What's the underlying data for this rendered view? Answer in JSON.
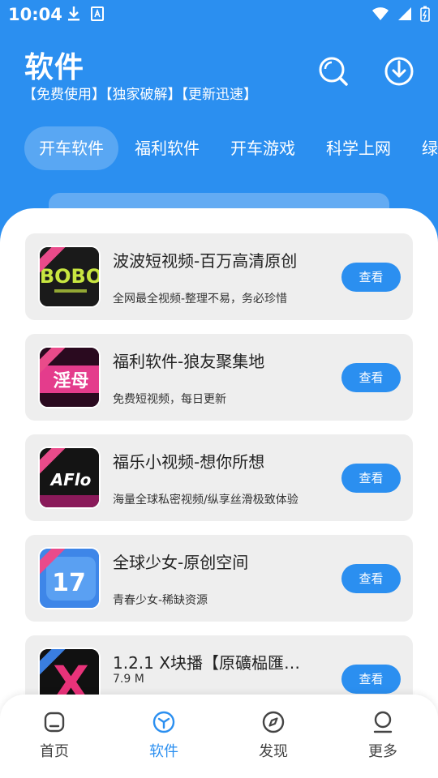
{
  "status_bar": {
    "time": "10:04"
  },
  "header": {
    "title": "软件",
    "subtitle": "【免费使用】【独家破解】【更新迅速】"
  },
  "tabs": [
    {
      "label": "开车软件",
      "active": true
    },
    {
      "label": "福利软件",
      "active": false
    },
    {
      "label": "开车游戏",
      "active": false
    },
    {
      "label": "科学上网",
      "active": false
    },
    {
      "label": "绿",
      "active": false
    }
  ],
  "apps": [
    {
      "name": "波波短视频-百万高清原创",
      "desc": "全网最全视频-整理不易，务必珍惜",
      "button": "查看",
      "icon_text": "BOBO"
    },
    {
      "name": "福利软件-狼友聚集地",
      "desc": "免费短视频，每日更新",
      "button": "查看",
      "icon_text": "淫母"
    },
    {
      "name": "福乐小视频-想你所想",
      "desc": "海量全球私密视频/纵享丝滑极致体验",
      "button": "查看",
      "icon_text": "AFlo"
    },
    {
      "name": "全球少女-原创空间",
      "desc": "青春少女-稀缺资源",
      "button": "查看",
      "icon_text": "17"
    },
    {
      "name": "1.2.1 X块播【原礦榀匯】…",
      "size": "7.9 M",
      "button": "查看",
      "icon_text": "X"
    }
  ],
  "bottom_nav": [
    {
      "label": "首页",
      "icon": "home-icon",
      "active": false
    },
    {
      "label": "软件",
      "icon": "cube-icon",
      "active": true
    },
    {
      "label": "发现",
      "icon": "compass-icon",
      "active": false
    },
    {
      "label": "更多",
      "icon": "person-icon",
      "active": false
    }
  ],
  "colors": {
    "primary": "#2b8ff0",
    "card": "#eeeeee",
    "ribbon": "#e94b8a"
  }
}
